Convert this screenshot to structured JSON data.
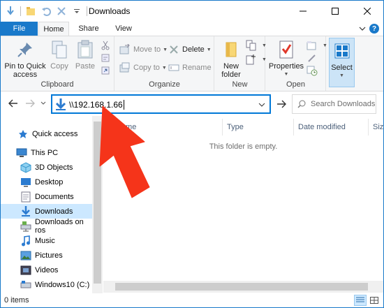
{
  "window": {
    "title": "Downloads",
    "controls": [
      "minimize",
      "maximize",
      "close"
    ]
  },
  "ribbon_tabs": {
    "file": "File",
    "home": "Home",
    "share": "Share",
    "view": "View"
  },
  "ribbon": {
    "clipboard": {
      "label": "Clipboard",
      "pin": "Pin to Quick access",
      "pin_line1": "Pin to Quick",
      "pin_line2": "access",
      "copy": "Copy",
      "paste": "Paste"
    },
    "organize": {
      "label": "Organize",
      "move_to": "Move to",
      "copy_to": "Copy to",
      "delete": "Delete",
      "rename": "Rename"
    },
    "new": {
      "label": "New",
      "new_folder_line1": "New",
      "new_folder_line2": "folder"
    },
    "open": {
      "label": "Open",
      "properties": "Properties"
    },
    "select": {
      "label": "Select"
    }
  },
  "address": {
    "value": "\\\\192.168.1.66",
    "search_placeholder": "Search Downloads"
  },
  "nav": {
    "items": [
      {
        "label": "Quick access",
        "icon": "star-icon"
      },
      {
        "label": "This PC",
        "icon": "computer-icon"
      },
      {
        "label": "3D Objects",
        "icon": "cube-icon"
      },
      {
        "label": "Desktop",
        "icon": "desktop-icon"
      },
      {
        "label": "Documents",
        "icon": "document-icon"
      },
      {
        "label": "Downloads",
        "icon": "download-icon"
      },
      {
        "label": "Downloads on ros",
        "icon": "network-drive-icon"
      },
      {
        "label": "Music",
        "icon": "music-icon"
      },
      {
        "label": "Pictures",
        "icon": "pictures-icon"
      },
      {
        "label": "Videos",
        "icon": "videos-icon"
      },
      {
        "label": "Windows10 (C:)",
        "icon": "drive-icon"
      }
    ],
    "selected": "Downloads"
  },
  "columns": [
    "Name",
    "Type",
    "Date modified",
    "Size"
  ],
  "empty_message": "This folder is empty.",
  "status": {
    "items": "0 items"
  },
  "colors": {
    "accent": "#1979ca",
    "annotation": "#f5341a",
    "selection": "#cce8ff"
  }
}
